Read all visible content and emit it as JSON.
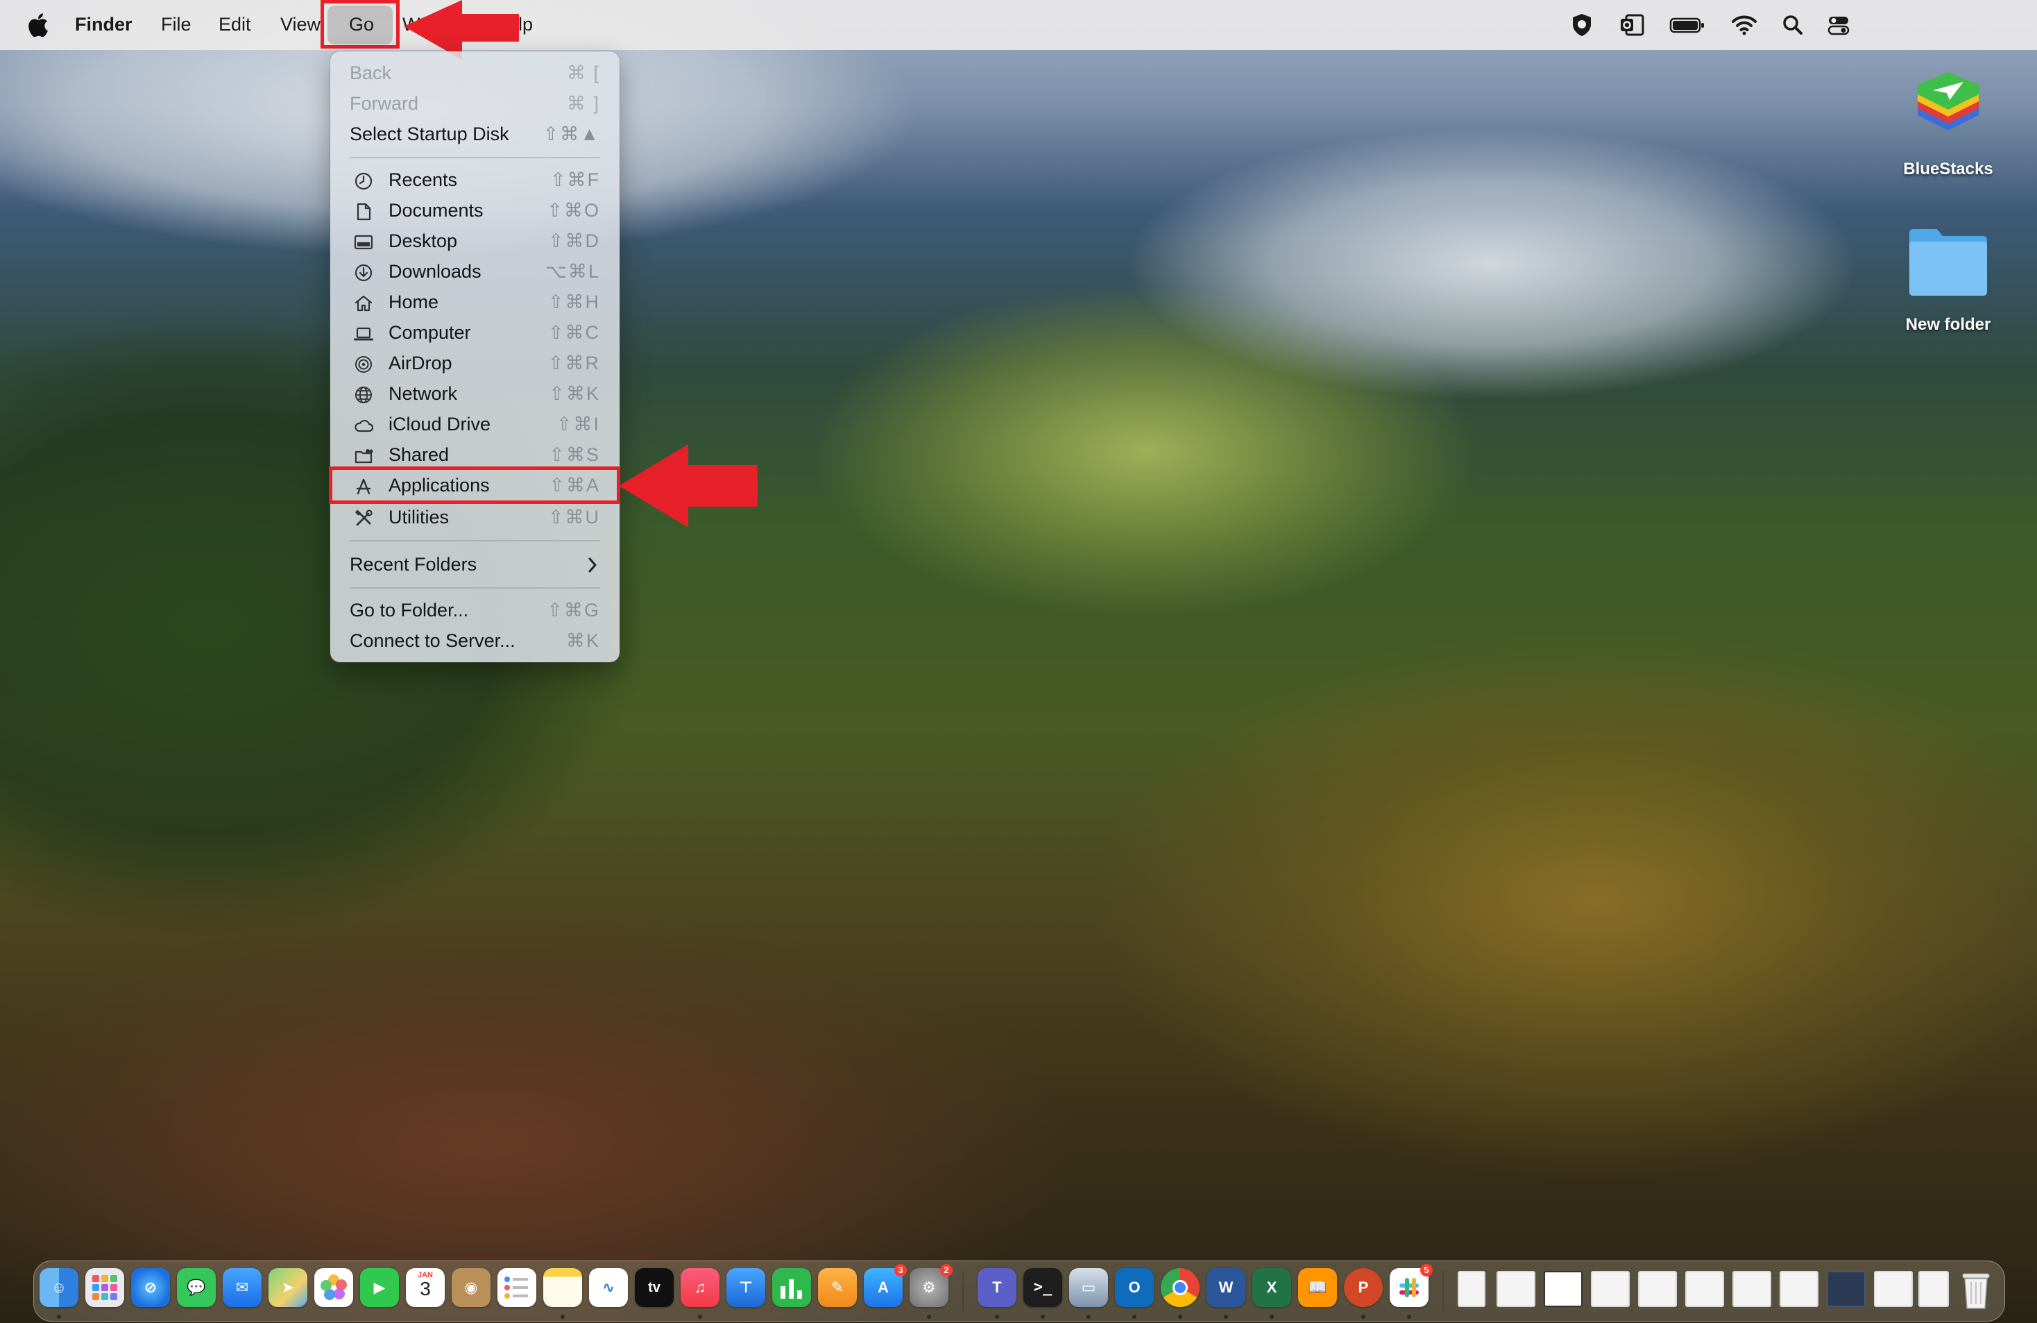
{
  "menubar": {
    "app_name": "Finder",
    "menus": [
      "File",
      "Edit",
      "View",
      "Go",
      "W",
      "elp"
    ]
  },
  "go_menu": {
    "items": [
      {
        "label": "Back",
        "shortcut": "⌘ [",
        "disabled": true
      },
      {
        "label": "Forward",
        "shortcut": "⌘ ]",
        "disabled": true
      },
      {
        "label": "Select Startup Disk",
        "shortcut": "⇧⌘▲"
      },
      {
        "label": "Recents",
        "shortcut": "⇧⌘F",
        "icon": "clock-icon"
      },
      {
        "label": "Documents",
        "shortcut": "⇧⌘O",
        "icon": "document-icon"
      },
      {
        "label": "Desktop",
        "shortcut": "⇧⌘D",
        "icon": "desktop-icon"
      },
      {
        "label": "Downloads",
        "shortcut": "⌥⌘L",
        "icon": "download-icon"
      },
      {
        "label": "Home",
        "shortcut": "⇧⌘H",
        "icon": "house-icon"
      },
      {
        "label": "Computer",
        "shortcut": "⇧⌘C",
        "icon": "laptop-icon"
      },
      {
        "label": "AirDrop",
        "shortcut": "⇧⌘R",
        "icon": "airdrop-icon"
      },
      {
        "label": "Network",
        "shortcut": "⇧⌘K",
        "icon": "globe-icon"
      },
      {
        "label": "iCloud Drive",
        "shortcut": "⇧⌘I",
        "icon": "cloud-icon"
      },
      {
        "label": "Shared",
        "shortcut": "⇧⌘S",
        "icon": "shared-folder-icon"
      },
      {
        "label": "Applications",
        "shortcut": "⇧⌘A",
        "icon": "applications-icon"
      },
      {
        "label": "Utilities",
        "shortcut": "⇧⌘U",
        "icon": "tools-icon"
      },
      {
        "label": "Recent Folders",
        "submenu": true
      },
      {
        "label": "Go to Folder...",
        "shortcut": "⇧⌘G"
      },
      {
        "label": "Connect to Server...",
        "shortcut": "⌘K"
      }
    ]
  },
  "desktop": {
    "items": [
      {
        "label": "BlueStacks",
        "icon": "bluestacks-app-icon"
      },
      {
        "label": "New folder",
        "icon": "folder-icon"
      }
    ]
  },
  "dock": {
    "calendar_day": "3",
    "calendar_month": "JAN",
    "badges": {
      "app_store": "3",
      "system_settings": "2",
      "slack": "5"
    }
  },
  "colors": {
    "annotation_red": "#e8202a",
    "menu_highlight": "#c9c9c9"
  }
}
